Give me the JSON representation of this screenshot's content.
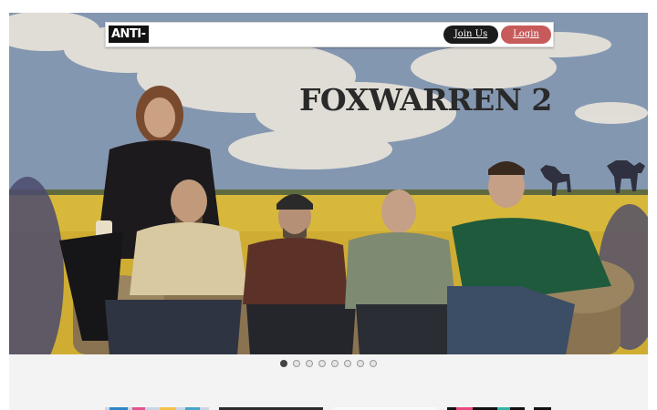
{
  "navbar": {
    "logo_text": "ANTI-",
    "join_label": "Join Us",
    "login_label": "Login"
  },
  "hero": {
    "title": "FOXWARREN 2",
    "carousel": {
      "slide_count": 8,
      "active_index": 0
    }
  },
  "thumbnails": [
    {
      "name": "album-thumb-1"
    },
    {
      "name": "album-thumb-2"
    },
    {
      "name": "album-thumb-3"
    },
    {
      "name": "album-thumb-4"
    }
  ],
  "colors": {
    "sky": "#7f93ad",
    "field": "#d9b93a",
    "join_button": "#1b1b1b",
    "login_button": "#c75a5a",
    "title_text": "#2a2a2a"
  }
}
